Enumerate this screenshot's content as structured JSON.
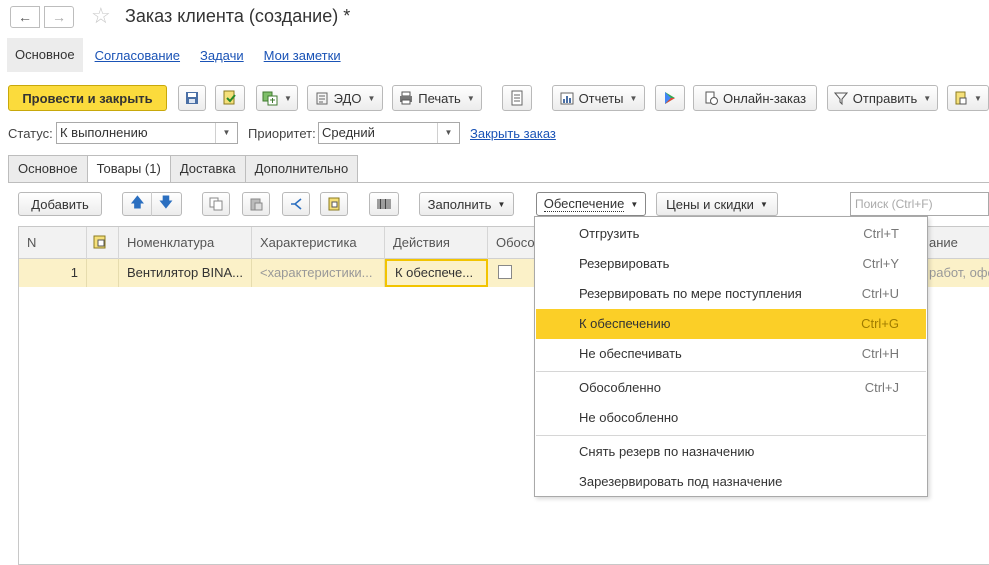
{
  "window": {
    "title": "Заказ клиента (создание) *",
    "back_glyph": "←",
    "forward_glyph": "→",
    "star_glyph": "☆"
  },
  "section_nav": {
    "current": "Основное",
    "links": [
      "Согласование",
      "Задачи",
      "Мои заметки"
    ]
  },
  "toolbar": {
    "post_close": "Провести и закрыть",
    "edo": "ЭДО",
    "print": "Печать",
    "reports": "Отчеты",
    "online_order": "Онлайн-заказ",
    "send": "Отправить"
  },
  "status": {
    "status_label": "Статус:",
    "status_value": "К выполнению",
    "priority_label": "Приоритет:",
    "priority_value": "Средний",
    "close_order_link": "Закрыть заказ"
  },
  "tabs": [
    "Основное",
    "Товары (1)",
    "Доставка",
    "Дополнительно"
  ],
  "goods_toolbar": {
    "add": "Добавить",
    "fill": "Заполнить",
    "supply": "Обеспечение",
    "prices": "Цены и скидки",
    "search_placeholder": "Поиск (Ctrl+F)"
  },
  "table": {
    "headers": {
      "n": "N",
      "nomenclature": "Номенклатура",
      "characteristic": "Характеристика",
      "actions": "Действия",
      "separated": "Обосо",
      "comment": "ание"
    },
    "row": {
      "n": "1",
      "nomenclature": "Вентилятор BINA...",
      "characteristic": "<характеристики...",
      "actions": "К обеспече...",
      "comment": "работ, офор"
    }
  },
  "supply_menu": {
    "items": [
      {
        "label": "Отгрузить",
        "key": "Ctrl+T"
      },
      {
        "label": "Резервировать",
        "key": "Ctrl+Y"
      },
      {
        "label": "Резервировать по мере поступления",
        "key": "Ctrl+U"
      },
      {
        "label": "К обеспечению",
        "key": "Ctrl+G"
      },
      {
        "label": "Не обеспечивать",
        "key": "Ctrl+H"
      },
      {
        "label": "Обособленно",
        "key": "Ctrl+J"
      },
      {
        "label": "Не обособленно",
        "key": ""
      },
      {
        "label": "Снять резерв по назначению",
        "key": ""
      },
      {
        "label": "Зарезервировать под назначение",
        "key": ""
      }
    ],
    "highlight_color": "#fbcf27"
  }
}
